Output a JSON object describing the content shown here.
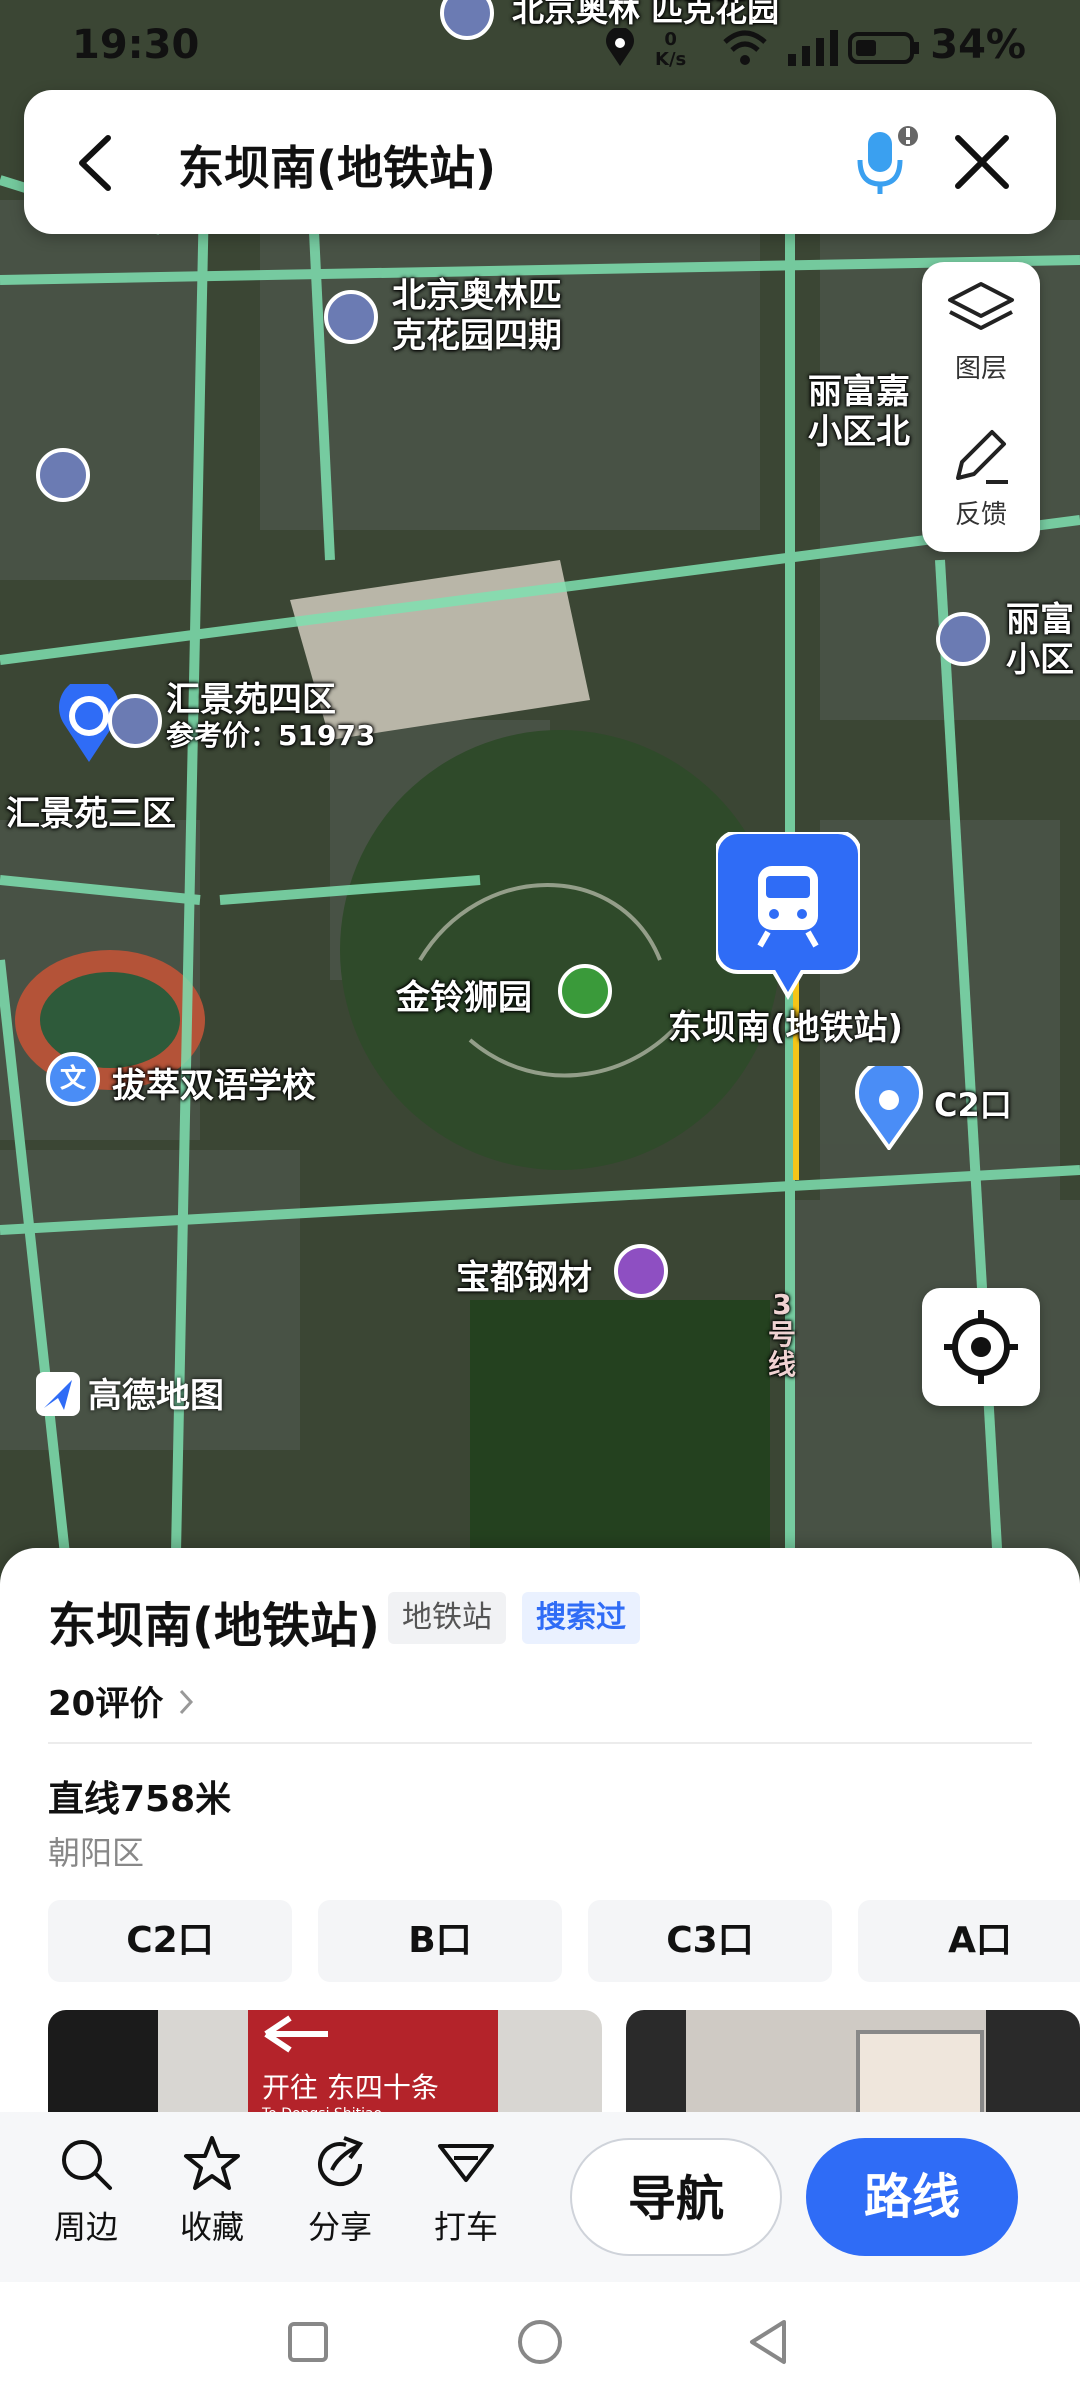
{
  "status_bar": {
    "time": "19:30",
    "net_speed": "0\nK/s",
    "battery": "34%"
  },
  "search": {
    "title": "东坝南(地铁站)"
  },
  "tools": {
    "layers_label": "图层",
    "feedback_label": "反馈"
  },
  "map_labels": {
    "top_poi": "北京奥林\n匹克花园",
    "olympic_garden_4": "北京奥林匹\n克花园四期",
    "lifujia_north": "丽富嘉\n小区北",
    "lifu": "丽富\n小区",
    "huijingyuan4": "汇景苑四区",
    "huijingyuan4_price": "参考价：51973",
    "huijingyuan3": "汇景苑三区",
    "jinling_park": "金铃狮园",
    "station": "东坝南(地铁站)",
    "exit_c2": "C2口",
    "school": "拔萃双语学校",
    "school_icon": "文",
    "baodu": "宝都钢材",
    "line3": "3\n号\n线",
    "brand": "高德地图"
  },
  "sheet": {
    "name": "东坝南(地铁站)",
    "tag_type": "地铁站",
    "tag_searched": "搜索过",
    "reviews": "20评价",
    "distance": "直线758米",
    "district": "朝阳区",
    "exits": [
      "C2口",
      "B口",
      "C3口",
      "A口"
    ],
    "photo_sign_text": "开往 东四十条",
    "photo_sign_sub": "To Dongsi Shitiao"
  },
  "actions": {
    "nearby": "周边",
    "favorite": "收藏",
    "share": "分享",
    "taxi": "打车",
    "navigate": "导航",
    "route": "路线"
  },
  "colors": {
    "accent": "#2f6cf6",
    "road": "#7fe0b0",
    "subway_line": "#f5c518"
  }
}
